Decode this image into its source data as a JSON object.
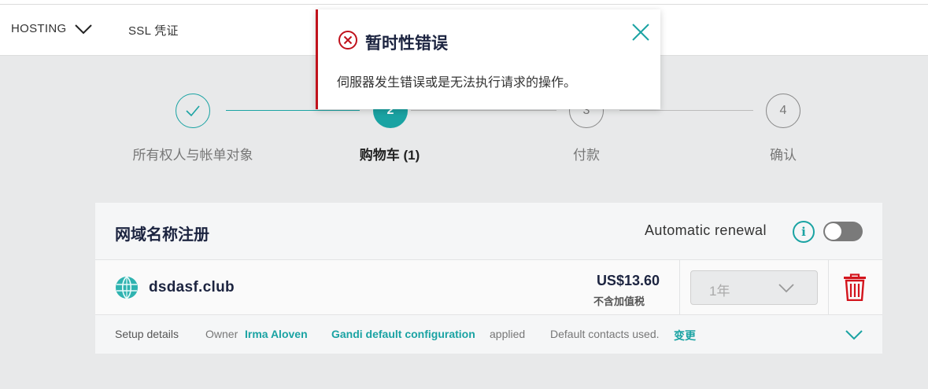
{
  "nav": {
    "hosting_label": "HOSTING",
    "ssl_label": "SSL 凭证"
  },
  "steps": [
    {
      "number": "",
      "label": "所有权人与帐单对象",
      "state": "done"
    },
    {
      "number": "2",
      "label": "购物车 (1)",
      "state": "active"
    },
    {
      "number": "3",
      "label": "付款",
      "state": "todo"
    },
    {
      "number": "4",
      "label": "确认",
      "state": "todo"
    }
  ],
  "card": {
    "title": "网域名称注册",
    "renewal_label": "Automatic renewal",
    "info_glyph": "i",
    "item": {
      "domain": "dsdasf.club",
      "price": "US$13.60",
      "tax_note": "不含加值税",
      "period": "1年"
    },
    "setup": {
      "label": "Setup details",
      "owner_prefix": "Owner",
      "owner_name": "Irma Aloven",
      "config_name": "Gandi default configuration",
      "config_suffix": "applied",
      "contacts_text": "Default contacts used.",
      "change_link": "变更"
    }
  },
  "toast": {
    "title": "暂时性错误",
    "message": "伺服器发生错误或是无法执行请求的操作。"
  },
  "colors": {
    "accent": "#1aa3a3",
    "error": "#c0121c",
    "navy": "#1c2440"
  }
}
